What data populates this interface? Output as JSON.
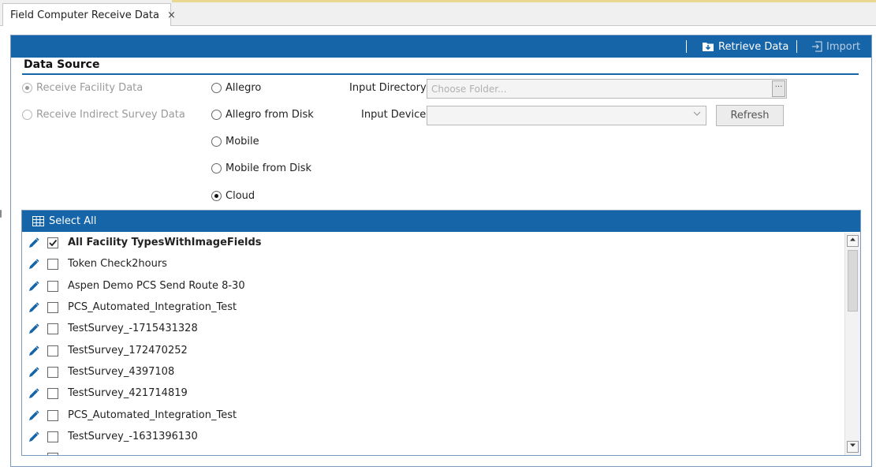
{
  "tab": {
    "title": "Field Computer Receive Data",
    "close_glyph": "×"
  },
  "toolbar": {
    "retrieve_label": "Retrieve Data",
    "import_label": "Import"
  },
  "data_source": {
    "title": "Data Source",
    "receive_options": [
      {
        "label": "Receive Facility Data",
        "checked": true,
        "disabled": true
      },
      {
        "label": "Receive Indirect Survey Data",
        "checked": false,
        "disabled": true
      }
    ],
    "sources": [
      {
        "label": "Allegro",
        "checked": false
      },
      {
        "label": "Allegro from Disk",
        "checked": false
      },
      {
        "label": "Mobile",
        "checked": false
      },
      {
        "label": "Mobile from Disk",
        "checked": false
      },
      {
        "label": "Cloud",
        "checked": true
      }
    ],
    "input_directory_label": "Input Directory",
    "input_directory_placeholder": "Choose Folder...",
    "browse_glyph": "···",
    "input_device_label": "Input Device",
    "input_device_value": "",
    "refresh_label": "Refresh"
  },
  "list": {
    "select_all_label": "Select All",
    "items": [
      {
        "label": "All Facility TypesWithImageFields",
        "checked": true,
        "bold": true
      },
      {
        "label": "Token Check2hours",
        "checked": false,
        "bold": false
      },
      {
        "label": "Aspen Demo PCS Send Route 8-30",
        "checked": false,
        "bold": false
      },
      {
        "label": "PCS_Automated_Integration_Test",
        "checked": false,
        "bold": false
      },
      {
        "label": "TestSurvey_-1715431328",
        "checked": false,
        "bold": false
      },
      {
        "label": "TestSurvey_172470252",
        "checked": false,
        "bold": false
      },
      {
        "label": "TestSurvey_4397108",
        "checked": false,
        "bold": false
      },
      {
        "label": "TestSurvey_421714819",
        "checked": false,
        "bold": false
      },
      {
        "label": "PCS_Automated_Integration_Test",
        "checked": false,
        "bold": false
      },
      {
        "label": "TestSurvey_-1631396130",
        "checked": false,
        "bold": false
      }
    ]
  },
  "colors": {
    "accent": "#1565a8",
    "icon": "#1565a8"
  }
}
